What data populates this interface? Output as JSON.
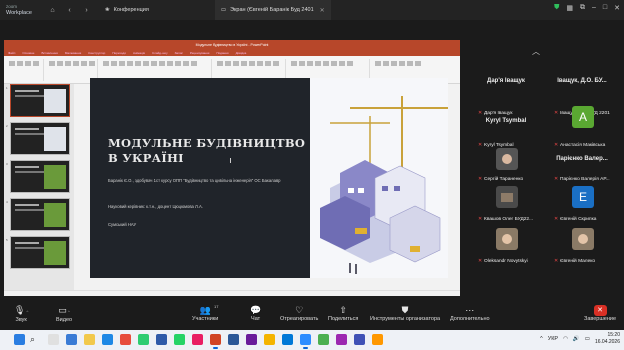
{
  "app": {
    "brand_line1": "zoom",
    "brand_line2": "Workplace"
  },
  "tabs": [
    {
      "label": "Конференция",
      "icon": "paw-icon"
    },
    {
      "label": "Экран (Євгеній Баранік Буд 2401",
      "icon": "screen-share-icon"
    }
  ],
  "ppt": {
    "window_title": "Модульне будівництво в Україні - PowerPoint",
    "ribbon_tabs": [
      "Файл",
      "Основне",
      "Вставлення",
      "Малювання",
      "Конструктор",
      "Переходи",
      "Анімація",
      "Слайд-шоу",
      "Запис",
      "Рецензування",
      "Подання",
      "Довідка"
    ],
    "thumbnails": [
      "1",
      "2",
      "3",
      "4",
      "5"
    ]
  },
  "slide": {
    "title": "МОДУЛЬНЕ БУДІВНИЦТВО В УКРАЇНІ",
    "author": "Баранік Є.О., здобувач 1ст курсу ОПП \"Будівництво та цивільна інженерія\" ОС Бакалавр",
    "supervisor": "Науковий керівник: к.т.н., доцент Цюцюмова Л.А.",
    "university": "Сумський НАУ"
  },
  "participants": [
    {
      "name": "Дар'я Іващук",
      "label": "Дар'я Іващук",
      "avatar": "",
      "avatar_color": ""
    },
    {
      "name": "Іващук, Д.О. БУ...",
      "label": "Іващук, Д.О. БУД 2201",
      "avatar": "",
      "avatar_color": ""
    },
    {
      "name": "Kyryl Tsymbal",
      "label": "Kyryl Tsymbal",
      "avatar": "",
      "avatar_color": ""
    },
    {
      "name": "",
      "label": "Анастасія Маківська",
      "avatar": "A",
      "avatar_color": "#5aa832"
    },
    {
      "name": "",
      "label": "Сергій Тараненко",
      "avatar": "",
      "avatar_color": "#4a4a4a"
    },
    {
      "name": "Парієнко Валер...",
      "label": "Парієнко Валерія АР...",
      "avatar": "",
      "avatar_color": ""
    },
    {
      "name": "",
      "label": "Квашов Олег БУД22...",
      "avatar": "",
      "avatar_color": "#4a4a4a"
    },
    {
      "name": "",
      "label": "Євгеній Скрипка",
      "avatar": "E",
      "avatar_color": "#1a6fc4"
    },
    {
      "name": "",
      "label": "Oleksandr Novytskyi",
      "avatar": "",
      "avatar_color": "#8a7a66"
    },
    {
      "name": "",
      "label": "Євгеній Малеко",
      "avatar": "",
      "avatar_color": "#8a7a66"
    }
  ],
  "controls": {
    "audio": "Звук",
    "video": "Видео",
    "participants": "Участники",
    "participants_count": "17",
    "chat": "Чат",
    "react": "Отреагировать",
    "share": "Поделиться",
    "host_tools": "Инструменты организатора",
    "more": "Дополнительно",
    "end": "Завершение"
  },
  "tray": {
    "lang": "УКР",
    "time": "15:20",
    "date": "16.04.2026"
  },
  "colors": {
    "ppt_red": "#b7472a",
    "end_red": "#d93025",
    "shield_green": "#2fbf5c"
  }
}
